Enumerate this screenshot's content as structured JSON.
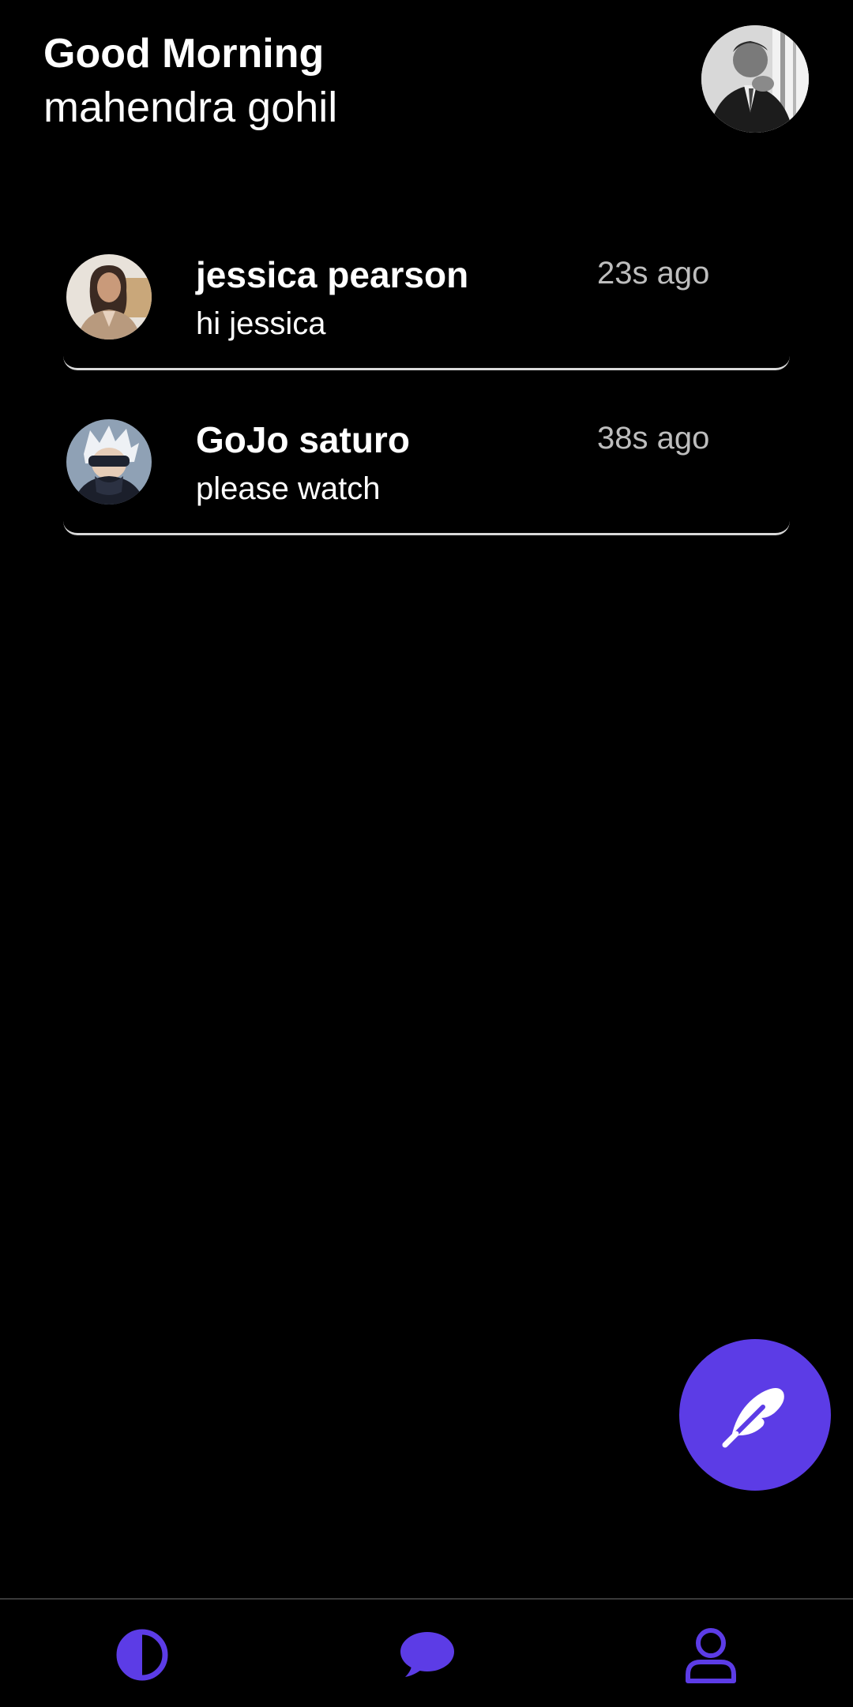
{
  "header": {
    "greeting": "Good Morning",
    "user_name": "mahendra gohil"
  },
  "chats": [
    {
      "name": "jessica pearson",
      "message": "hi jessica",
      "time": "23s ago"
    },
    {
      "name": "GoJo saturo",
      "message": "please watch",
      "time": "38s ago"
    }
  ],
  "fab": {
    "icon": "feather-icon"
  },
  "bottom_nav": {
    "items": [
      {
        "icon": "contrast-icon"
      },
      {
        "icon": "chat-bubble-icon"
      },
      {
        "icon": "person-icon"
      }
    ]
  },
  "colors": {
    "background": "#000000",
    "accent": "#5c3ce6",
    "text_primary": "#ffffff",
    "text_secondary": "#bdbdbd",
    "divider": "#d9d9d9"
  }
}
